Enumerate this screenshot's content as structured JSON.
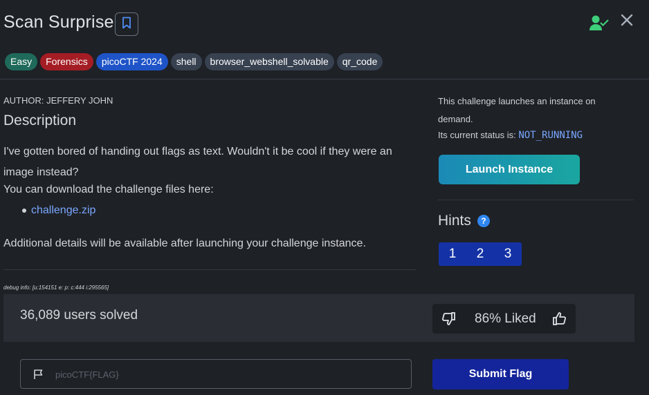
{
  "header": {
    "title": "Scan Surprise",
    "bookmark_icon": "bookmark-icon",
    "user_icon": "user-check-icon",
    "close_icon": "close-icon"
  },
  "tags": [
    {
      "label": "Easy",
      "color": "#1f6a5a"
    },
    {
      "label": "Forensics",
      "color": "#a51d24"
    },
    {
      "label": "picoCTF 2024",
      "color": "#1f54c8"
    },
    {
      "label": "shell",
      "color": "#374150"
    },
    {
      "label": "browser_webshell_solvable",
      "color": "#374150"
    },
    {
      "label": "qr_code",
      "color": "#374150"
    }
  ],
  "main": {
    "author": "AUTHOR: JEFFERY JOHN",
    "description_heading": "Description",
    "description_text": "I've gotten bored of handing out flags as text. Wouldn't it be cool if they were an image instead?",
    "download_text": "You can download the challenge files here:",
    "files": [
      "challenge.zip"
    ],
    "additional_text": "Additional details will be available after launching your challenge instance.",
    "debug_info": "debug info: [u:154151 e: p: c:444 i:295565]"
  },
  "instance": {
    "description": "This challenge launches an instance on demand.",
    "status_label": "Its current status is:",
    "status_value": "NOT_RUNNING",
    "launch_label": "Launch Instance"
  },
  "hints": {
    "heading": "Hints",
    "help_icon": "?",
    "buttons": [
      "1",
      "2",
      "3"
    ]
  },
  "stats": {
    "solved": "36,089 users solved",
    "liked": "86% Liked"
  },
  "flag": {
    "placeholder": "picoCTF{FLAG}",
    "value": "",
    "submit_label": "Submit Flag"
  },
  "colors": {
    "background": "#1e2126",
    "accent_link": "#7aa7ff",
    "submit": "#14259b",
    "success": "#3ecf7a"
  }
}
